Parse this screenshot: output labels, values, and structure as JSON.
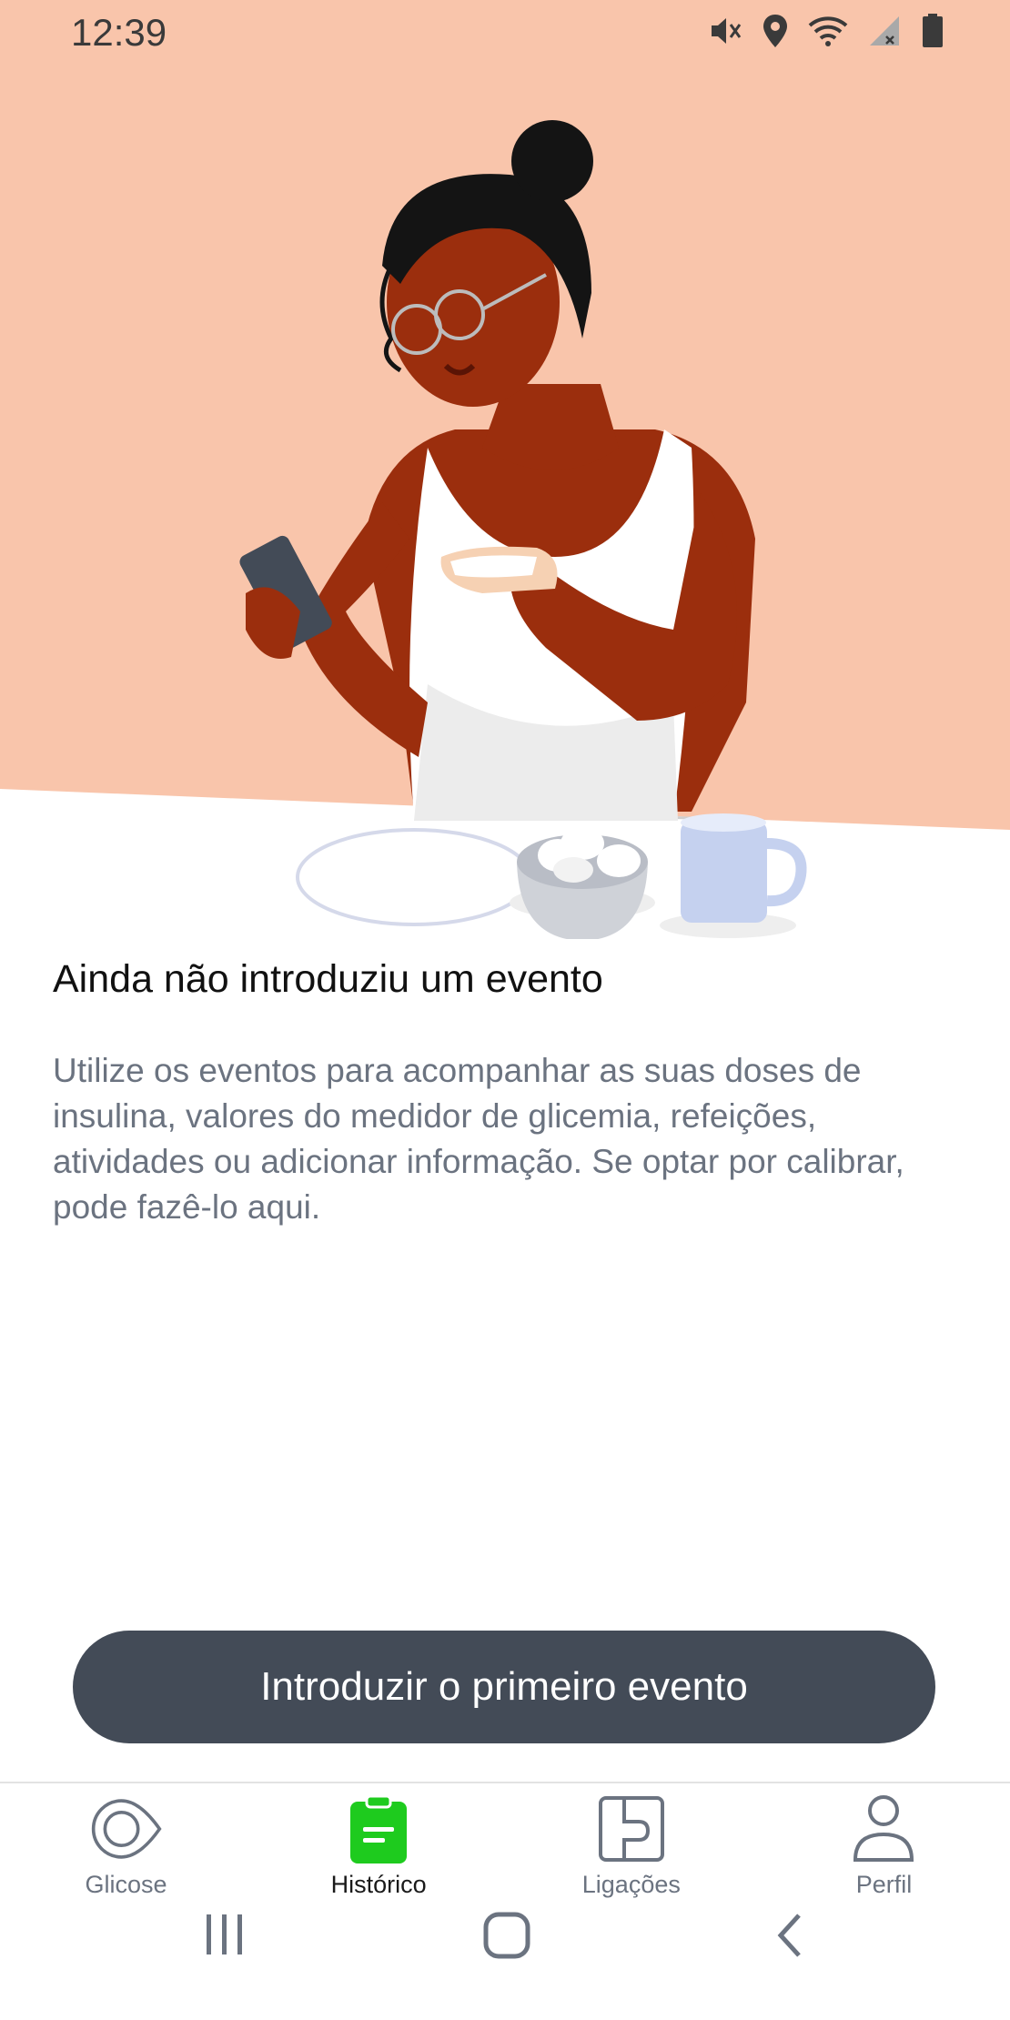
{
  "status_bar": {
    "time": "12:39",
    "icons": [
      "mute-icon",
      "location-icon",
      "wifi-icon",
      "signal-icon",
      "battery-icon"
    ]
  },
  "hero": {
    "background_color": "#f9c5ab",
    "illustration": "woman-eating-toast-with-phone"
  },
  "empty_state": {
    "title": "Ainda não introduziu um evento",
    "description": "Utilize os eventos para acompanhar as suas doses de insulina, valores do medidor de glicemia, refeições, atividades ou adicionar informação. Se optar por calibrar, pode fazê-lo aqui."
  },
  "cta": {
    "label": "Introduzir o primeiro evento",
    "background_color": "#434b57"
  },
  "bottom_nav": {
    "items": [
      {
        "label": "Glicose",
        "icon": "glucose-sensor-icon",
        "active": false
      },
      {
        "label": "Histórico",
        "icon": "clipboard-icon",
        "active": true
      },
      {
        "label": "Ligações",
        "icon": "connections-icon",
        "active": false
      },
      {
        "label": "Perfil",
        "icon": "profile-icon",
        "active": false
      }
    ],
    "active_color": "#1ecb1e"
  },
  "system_nav": {
    "icons": [
      "recents-icon",
      "home-icon",
      "back-icon"
    ]
  }
}
